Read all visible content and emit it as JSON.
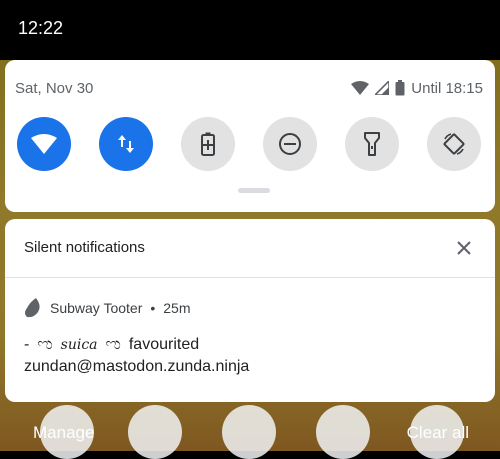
{
  "status_bar": {
    "time": "12:22"
  },
  "quick_settings": {
    "date": "Sat, Nov 30",
    "battery_text": "Until 18:15",
    "tiles": [
      {
        "name": "wifi",
        "icon": "wifi-icon",
        "state": "on"
      },
      {
        "name": "mobile-data",
        "icon": "data-arrows-icon",
        "state": "on"
      },
      {
        "name": "battery-saver",
        "icon": "battery-saver-icon",
        "state": "off"
      },
      {
        "name": "do-not-disturb",
        "icon": "dnd-icon",
        "state": "off"
      },
      {
        "name": "flashlight",
        "icon": "flashlight-icon",
        "state": "off"
      },
      {
        "name": "auto-rotate",
        "icon": "rotate-icon",
        "state": "off"
      }
    ],
    "colors": {
      "active": "#1a73e8",
      "inactive": "#e2e2e2"
    }
  },
  "notifications": {
    "section_title": "Silent notifications",
    "item": {
      "app_name": "Subway Tooter",
      "time_ago": "25m",
      "separator": "•",
      "prefix": "-",
      "display_name": "suica",
      "action": "favourited",
      "account": "zundan@mastodon.zunda.ninja"
    }
  },
  "footer": {
    "manage_label": "Manage",
    "clear_label": "Clear all"
  }
}
